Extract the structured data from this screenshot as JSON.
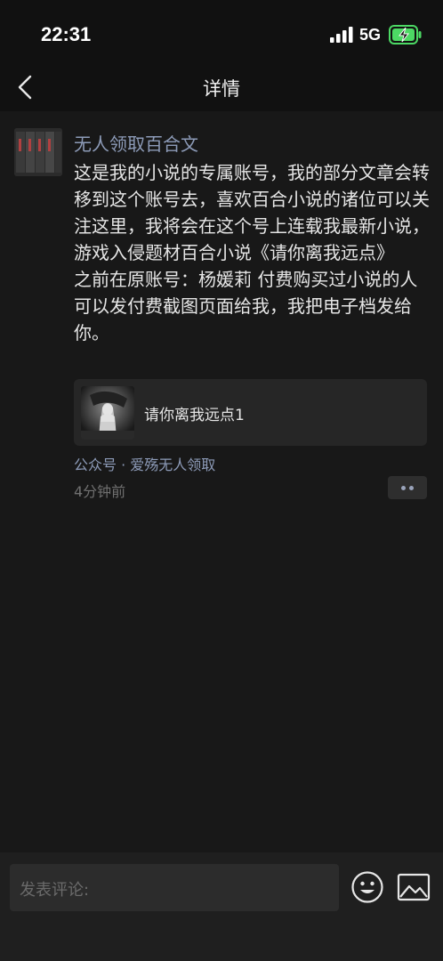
{
  "status_bar": {
    "time": "22:31",
    "network": "5G"
  },
  "nav": {
    "title": "详情"
  },
  "post": {
    "author": "无人领取百合文",
    "text": "这是我的小说的专属账号，我的部分文章会转移到这个账号去，喜欢百合小说的诸位可以关注这里，我将会在这个号上连载我最新小说，游戏入侵题材百合小说《请你离我远点》\n之前在原账号：杨媛莉 付费购买过小说的人可以发付费截图页面给我，我把电子档发给你。",
    "article_card": {
      "title": "请你离我远点1"
    },
    "source": "公众号 · 爱殇无人领取",
    "time_ago": "4分钟前"
  },
  "comment_bar": {
    "placeholder": "发表评论:"
  },
  "icons": {
    "back": "chevron-left-icon",
    "signal": "signal-bars-icon",
    "battery": "battery-charging-icon",
    "more": "more-dots-icon",
    "emoji": "smiley-icon",
    "image": "image-icon"
  },
  "colors": {
    "background": "#181818",
    "header": "#111111",
    "link": "#8d9bb8",
    "battery": "#4cd964"
  }
}
